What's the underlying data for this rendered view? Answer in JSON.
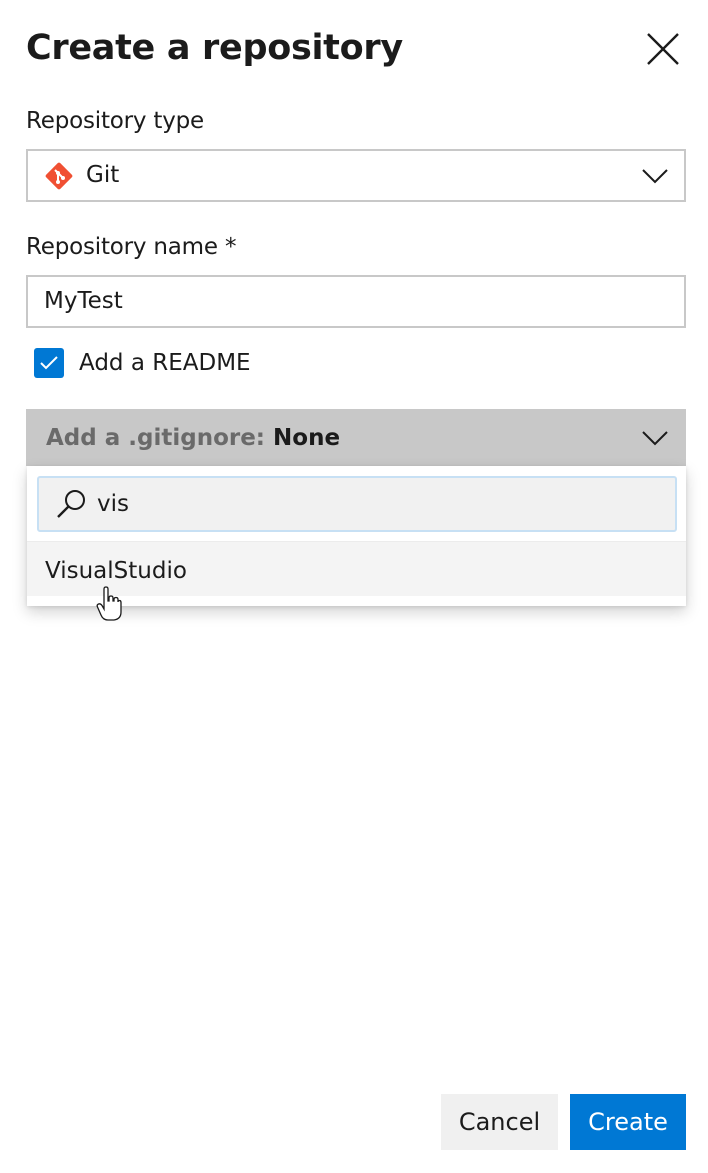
{
  "dialog": {
    "title": "Create a repository"
  },
  "repository_type": {
    "label": "Repository type",
    "value": "Git",
    "icon": "git-logo-icon"
  },
  "repository_name": {
    "label": "Repository name *",
    "value": "MyTest"
  },
  "readme": {
    "label": "Add a README",
    "checked": true
  },
  "gitignore": {
    "prefix": "Add a .gitignore:",
    "value": "None",
    "search_query": "vis",
    "options": [
      "VisualStudio"
    ]
  },
  "footer": {
    "cancel_label": "Cancel",
    "create_label": "Create"
  },
  "colors": {
    "accent": "#0078d4",
    "git_brand": "#f05033",
    "dropdown_bg": "#c8c8c8"
  }
}
